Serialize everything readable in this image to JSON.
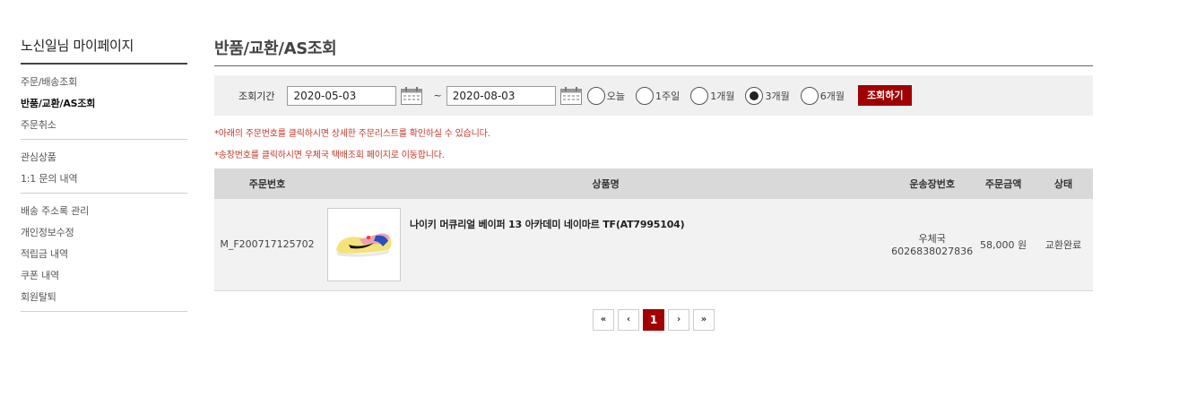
{
  "sidebar": {
    "title": "노신일님 마이페이지",
    "groups": [
      [
        {
          "label": "주문/배송조회",
          "active": false
        },
        {
          "label": "반품/교환/AS조회",
          "active": true
        },
        {
          "label": "주문취소",
          "active": false
        }
      ],
      [
        {
          "label": "관심상품",
          "active": false
        },
        {
          "label": "1:1 문의 내역",
          "active": false
        }
      ],
      [
        {
          "label": "배송 주소록 관리",
          "active": false
        },
        {
          "label": "개인정보수정",
          "active": false
        },
        {
          "label": "적립금 내역",
          "active": false
        },
        {
          "label": "쿠폰 내역",
          "active": false
        },
        {
          "label": "회원탈퇴",
          "active": false
        }
      ]
    ]
  },
  "page": {
    "title": "반품/교환/AS조회"
  },
  "search": {
    "label": "조회기간",
    "start_date": "2020-05-03",
    "end_date": "2020-08-03",
    "separator": "~",
    "periods": [
      {
        "label": "오늘",
        "checked": false
      },
      {
        "label": "1주일",
        "checked": false
      },
      {
        "label": "1개월",
        "checked": false
      },
      {
        "label": "3개월",
        "checked": true
      },
      {
        "label": "6개월",
        "checked": false
      }
    ],
    "button_label": "조회하기"
  },
  "notices": [
    "*아래의 주문번호를 클릭하시면 상세한 주문리스트를 확인하실 수 있습니다.",
    "*송장번호를 클릭하시면 우체국 택배조회 페이지로 이동합니다."
  ],
  "table": {
    "headers": [
      "주문번호",
      "상품명",
      "운송장번호",
      "주문금액",
      "상태"
    ],
    "rows": [
      {
        "order_no": "M_F200717125702",
        "product_name": "나이키 머큐리얼 베이퍼 13 아카데미 네이마르 TF(AT7995104)",
        "product_image_icon": "sneaker-image",
        "carrier": "우체국",
        "tracking_no": "6026838027836",
        "amount": "58,000 원",
        "status": "교환완료"
      }
    ]
  },
  "pagination": {
    "first": "«",
    "prev": "‹",
    "current": "1",
    "next": "›",
    "last": "»"
  },
  "colors": {
    "accent": "#a00000",
    "notice": "#c0392b"
  }
}
